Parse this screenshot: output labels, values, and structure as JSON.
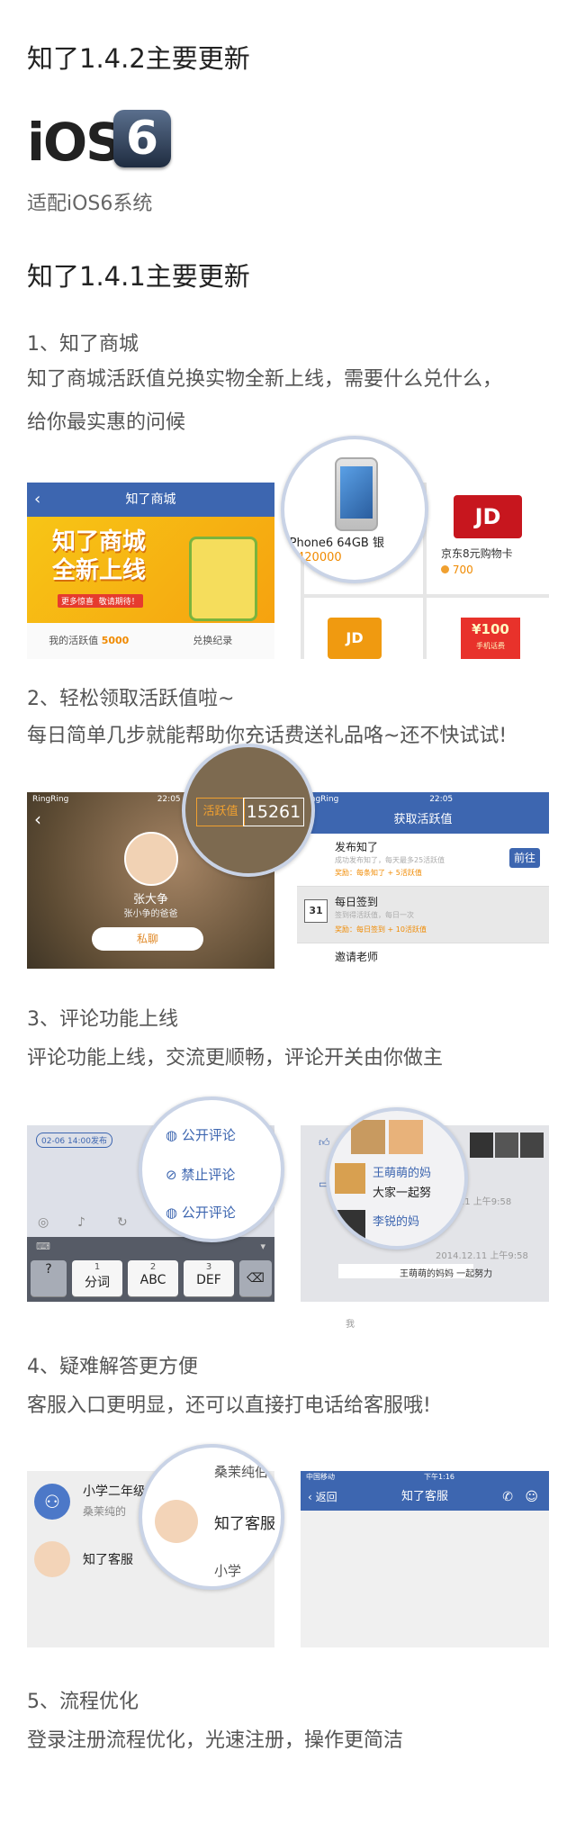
{
  "v142": {
    "title": "知了1.4.2主要更新",
    "ios_text": "iOS",
    "ios_num": "6",
    "desc": "适配iOS6系统"
  },
  "v141": {
    "title": "知了1.4.1主要更新"
  },
  "s1": {
    "title": "1、知了商城",
    "desc1": "知了商城活跃值兑换实物全新上线，需要什么兑什么，",
    "desc2": "给你最实惠的问候",
    "screen": {
      "nav_title": "知了商城",
      "banner_line1": "知了商城",
      "banner_line2": "全新上线",
      "banner_tag1": "更多惊喜",
      "banner_tag2": "敬请期待！",
      "my_value_label": "我的活跃值",
      "my_value": "5000",
      "exchange_record": "兑换纪录"
    },
    "products": {
      "iphone_name": "iPhone6 64GB 银",
      "iphone_price": "420000",
      "jd_name": "京东8元购物卡",
      "jd_price": "700",
      "jd_logo": "JD",
      "card_value": "¥100",
      "card_label": "手机话费"
    }
  },
  "s2": {
    "title": "2、轻松领取活跃值啦~",
    "desc": "每日简单几步就能帮助你充话费送礼品咯~还不快试试!",
    "profile": {
      "carrier": "RingRing",
      "time": "22:05",
      "name": "张大争",
      "subtitle": "张小争的爸爸",
      "private_msg": "私聊",
      "active_label": "活跃值",
      "active_value": "15261"
    },
    "tasks": {
      "carrier": "RingRing",
      "time": "22:05",
      "nav_title": "获取活跃值",
      "task1_title": "发布知了",
      "task1_desc": "成功发布知了，每天最多25活跃值",
      "task1_reward": "奖励：每条知了 + 5活跃值",
      "task1_btn": "前往",
      "task2_title": "每日签到",
      "task2_desc": "签到得活跃值，每日一次",
      "task2_reward": "奖励：每日签到 + 10活跃值",
      "task2_icon": "31",
      "task3_title": "邀请老师"
    }
  },
  "s3": {
    "title": "3、评论功能上线",
    "desc": "评论功能上线，交流更顺畅，评论开关由你做主",
    "compose": {
      "date_tag": "02-06 14:00发布",
      "public_comment": "公开评论",
      "ban_comment": "禁止评论",
      "public_comment2": "公开评论",
      "keys": [
        {
          "num": "",
          "label": "?"
        },
        {
          "num": "1",
          "label": "分词"
        },
        {
          "num": "2",
          "label": "ABC"
        },
        {
          "num": "3",
          "label": "DEF"
        }
      ]
    },
    "feed": {
      "user1": "王萌萌的妈",
      "msg1": "大家一起努",
      "time1": "01.11 上午9:58",
      "user2": "李锐的妈",
      "time2": "2014.12.11 上午9:58",
      "msg2": "王萌萌的妈妈 一起努力",
      "footer": "我"
    }
  },
  "s4": {
    "title": "4、疑难解答更方便",
    "desc": "客服入口更明显，还可以直接打电话给客服哦!",
    "chats": {
      "group_name": "小学二年级",
      "group_sub": "桑茉纯的",
      "service_name": "知了客服",
      "mag_name1": "桑茉纯伯",
      "mag_name2": "知了客服",
      "mag_name3": "小学"
    },
    "service": {
      "carrier": "中国移动",
      "time": "下午1:16",
      "back": "返回",
      "nav_title": "知了客服"
    }
  },
  "s5": {
    "title": "5、流程优化",
    "desc": "登录注册流程优化，光速注册，操作更简洁"
  }
}
